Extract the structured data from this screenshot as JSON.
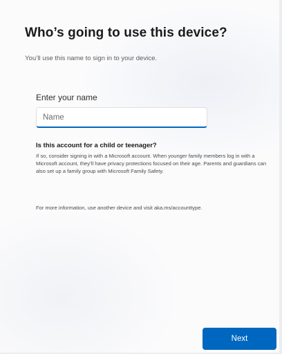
{
  "header": {
    "title": "Who’s going to use this device?",
    "subtitle": "You’ll use this name to sign in to your device."
  },
  "name_field": {
    "label": "Enter your name",
    "placeholder": "Name",
    "value": ""
  },
  "child_account": {
    "heading": "Is this account for a child or teenager?",
    "body": "If so, consider signing in with a Microsoft account. When younger family members log in with a Microsoft account, they’ll have privacy protections focused on their age. Parents and guardians can also set up a family group with Microsoft Family Safety.",
    "more_info": "For more information, use another device and visit aka.ms/accounttype."
  },
  "footer": {
    "next_label": "Next"
  },
  "colors": {
    "accent": "#0067c0",
    "background": "#fbfbfc",
    "text_primary": "#1b1b1b",
    "text_secondary": "#5c5c5c"
  }
}
